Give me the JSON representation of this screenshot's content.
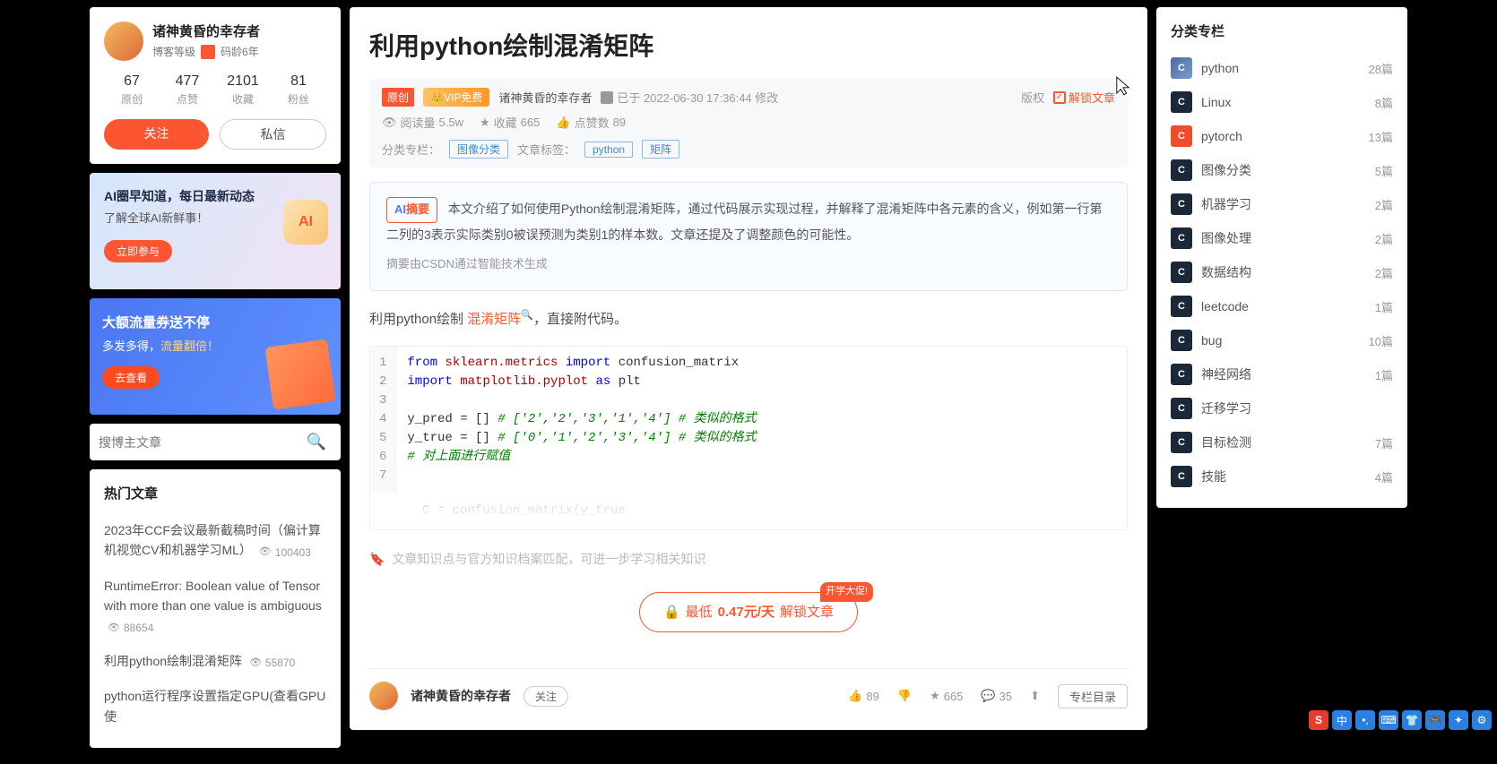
{
  "author": {
    "name": "诸神黄昏的幸存者",
    "level_label": "博客等级",
    "age_label": "码龄6年",
    "stats": [
      {
        "num": "67",
        "label": "原创"
      },
      {
        "num": "477",
        "label": "点赞"
      },
      {
        "num": "2101",
        "label": "收藏"
      },
      {
        "num": "81",
        "label": "粉丝"
      }
    ],
    "follow_btn": "关注",
    "message_btn": "私信"
  },
  "promo1": {
    "line1": "AI圈早知道，每日最新动态",
    "line2": "了解全球AI新鲜事！",
    "btn": "立即参与",
    "icon_text": "AI"
  },
  "promo2": {
    "line1": "大额流量券送不停",
    "line2a": "多发多得，",
    "line2b": "流量翻倍！",
    "btn": "去查看"
  },
  "search": {
    "placeholder": "搜博主文章"
  },
  "hot": {
    "title": "热门文章",
    "items": [
      {
        "text": "2023年CCF会议最新截稿时间（偏计算机视觉CV和机器学习ML）",
        "views": "100403"
      },
      {
        "text": "RuntimeError: Boolean value of Tensor with more than one value is ambiguous",
        "views": "88654"
      },
      {
        "text": "利用python绘制混淆矩阵",
        "views": "55870"
      },
      {
        "text": "python运行程序设置指定GPU(查看GPU使",
        "views": ""
      }
    ]
  },
  "article": {
    "title": "利用python绘制混淆矩阵",
    "orig_tag": "原创",
    "vip_tag": "👑VIP免费",
    "author": "诸神黄昏的幸存者",
    "date": "已于 2022-06-30 17:36:44 修改",
    "copyright": "版权",
    "unlock": "解锁文章",
    "reads_label": "阅读量",
    "reads": "5.5w",
    "fav_label": "收藏",
    "fav": "665",
    "like_label": "点赞数",
    "like": "89",
    "column_label": "分类专栏：",
    "column_tag": "图像分类",
    "tags_label": "文章标签：",
    "tag1": "python",
    "tag2": "矩阵"
  },
  "abstract": {
    "tag_a": "AI",
    "tag_b": "摘要",
    "text": "本文介绍了如何使用Python绘制混淆矩阵，通过代码展示实现过程，并解释了混淆矩阵中各元素的含义，例如第一行第二列的3表示实际类别0被误预测为类别1的样本数。文章还提及了调整颜色的可能性。",
    "note": "摘要由CSDN通过智能技术生成"
  },
  "body_intro_a": "利用python绘制 ",
  "body_intro_link": "混淆矩阵",
  "body_intro_b": "，直接附代码。",
  "code": {
    "l1a": "from",
    "l1b": "sklearn.metrics",
    "l1c": "import",
    "l1d": "confusion_matrix",
    "l2a": "import",
    "l2b": "matplotlib.pyplot",
    "l2c": "as",
    "l2d": "plt",
    "l4a": "y_pred = []",
    "l4b": "# ['2','2','3','1','4'] # 类似的格式",
    "l5a": "y_true = []",
    "l5b": "# ['0','1','2','3','4'] # 类似的格式",
    "l6": "# 对上面进行赋值",
    "faded": "C = confusion_matrix(y_true"
  },
  "knowledge_hint": "文章知识点与官方知识档案匹配，可进一步学习相关知识",
  "unlock_btn": {
    "prefix": "最低",
    "price": "0.47元/天",
    "suffix": " 解锁文章",
    "badge": "开学大促!"
  },
  "bottom": {
    "name": "诸神黄昏的幸存者",
    "follow": "关注",
    "like": "89",
    "fav": "665",
    "comment": "35",
    "toc": "专栏目录"
  },
  "categories": {
    "title": "分类专栏",
    "items": [
      {
        "name": "python",
        "count": "28篇",
        "cls": "py"
      },
      {
        "name": "Linux",
        "count": "8篇",
        "cls": ""
      },
      {
        "name": "pytorch",
        "count": "13篇",
        "cls": "pt"
      },
      {
        "name": "图像分类",
        "count": "5篇",
        "cls": ""
      },
      {
        "name": "机器学习",
        "count": "2篇",
        "cls": ""
      },
      {
        "name": "图像处理",
        "count": "2篇",
        "cls": ""
      },
      {
        "name": "数据结构",
        "count": "2篇",
        "cls": ""
      },
      {
        "name": "leetcode",
        "count": "1篇",
        "cls": ""
      },
      {
        "name": "bug",
        "count": "10篇",
        "cls": ""
      },
      {
        "name": "神经网络",
        "count": "1篇",
        "cls": ""
      },
      {
        "name": "迁移学习",
        "count": "",
        "cls": ""
      },
      {
        "name": "目标检测",
        "count": "7篇",
        "cls": ""
      },
      {
        "name": "技能",
        "count": "4篇",
        "cls": ""
      }
    ]
  },
  "ime": [
    "S",
    "中",
    "•,",
    "⌨",
    "👕",
    "🎮",
    "✦",
    "⚙"
  ]
}
